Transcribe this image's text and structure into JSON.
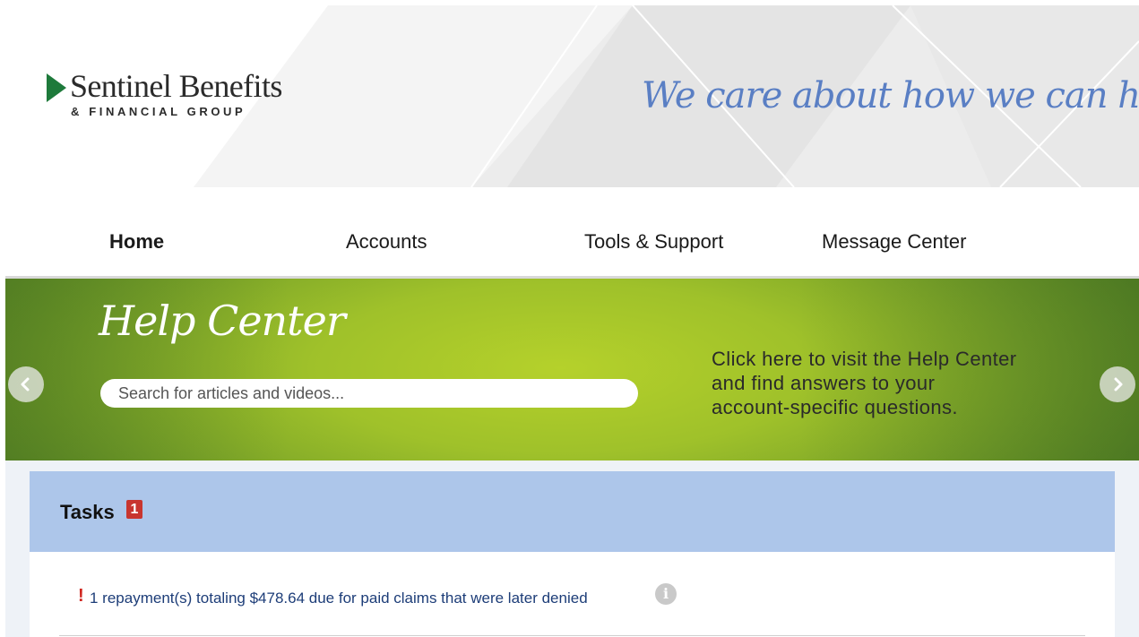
{
  "header": {
    "logo_name": "Sentinel Benefits",
    "logo_sub": "& FINANCIAL GROUP",
    "tagline": "We care about how we can help."
  },
  "nav": {
    "items": [
      {
        "label": "Home",
        "active": true
      },
      {
        "label": "Accounts",
        "active": false
      },
      {
        "label": "Tools & Support",
        "active": false
      },
      {
        "label": "Message Center",
        "active": false
      }
    ]
  },
  "banner": {
    "title": "Help Center",
    "search_placeholder": "Search for articles and videos...",
    "text_lines": [
      "Click here to visit the Help Center",
      "and find answers to your",
      "account-specific questions."
    ],
    "prev_icon": "chevron-left-icon",
    "next_icon": "chevron-right-icon"
  },
  "tasks": {
    "title": "Tasks",
    "badge_count": "1",
    "items": [
      {
        "alert": "!",
        "text": "1 repayment(s) totaling $478.64 due for paid claims that were later denied",
        "info_icon": "info-icon"
      }
    ]
  },
  "colors": {
    "brand_green": "#1e7a3b",
    "tagline_blue": "#5a7fc4",
    "tasks_header": "#adc6ea",
    "badge_red": "#c8352f",
    "task_link": "#1d3d78"
  }
}
